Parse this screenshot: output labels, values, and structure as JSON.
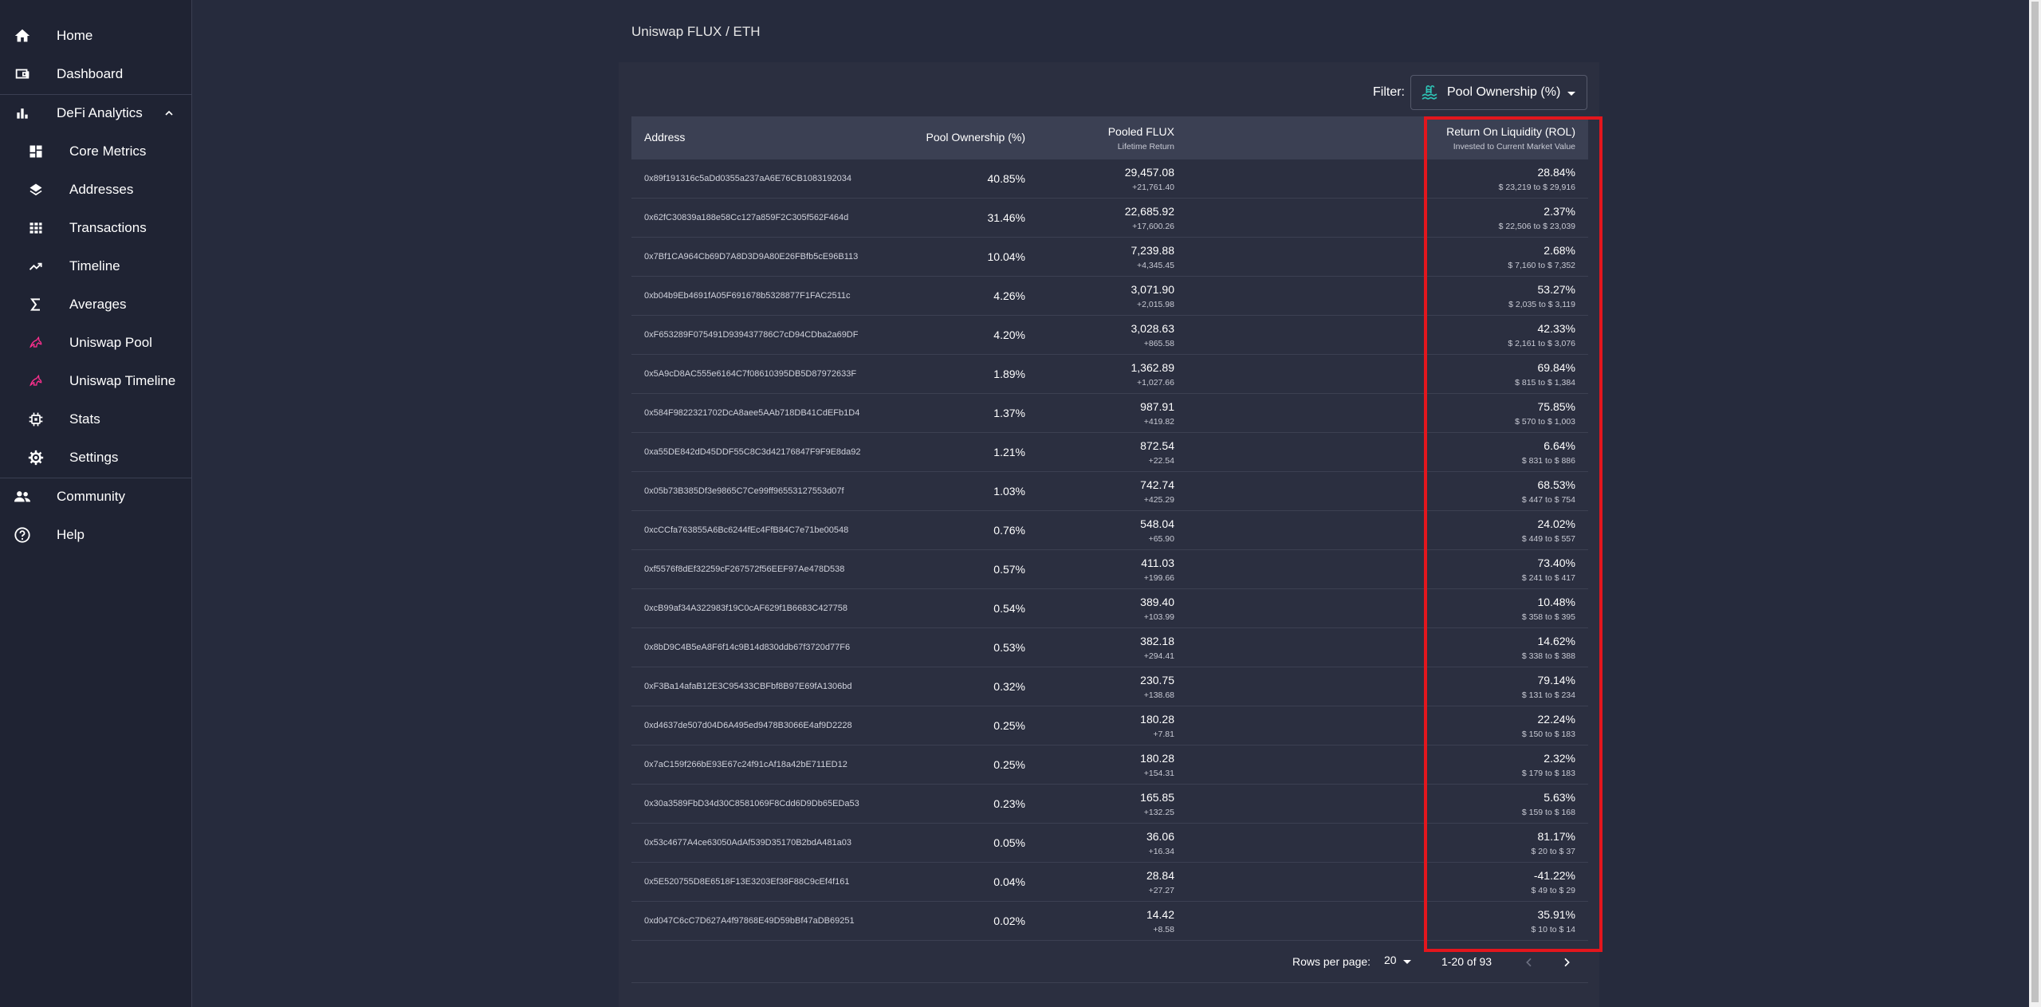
{
  "sidebar": {
    "items": [
      {
        "label": "Home",
        "icon": "home-icon"
      },
      {
        "label": "Dashboard",
        "icon": "wallet-icon"
      },
      {
        "label": "DeFi Analytics",
        "icon": "bar-chart-icon",
        "expanded": true
      },
      {
        "label": "Core Metrics",
        "icon": "dashboard-grid-icon"
      },
      {
        "label": "Addresses",
        "icon": "layers-icon"
      },
      {
        "label": "Transactions",
        "icon": "grid-table-icon"
      },
      {
        "label": "Timeline",
        "icon": "trending-up-icon"
      },
      {
        "label": "Averages",
        "icon": "sigma-icon"
      },
      {
        "label": "Uniswap Pool",
        "icon": "unicorn-icon"
      },
      {
        "label": "Uniswap Timeline",
        "icon": "unicorn-icon"
      },
      {
        "label": "Stats",
        "icon": "chip-icon"
      },
      {
        "label": "Settings",
        "icon": "gear-icon"
      },
      {
        "label": "Community",
        "icon": "people-icon"
      },
      {
        "label": "Help",
        "icon": "help-circle-icon"
      }
    ]
  },
  "page": {
    "title": "Uniswap FLUX / ETH"
  },
  "filter": {
    "label": "Filter:",
    "selected": "Pool Ownership (%)",
    "icon": "pool-icon",
    "icon_color": "#2ec4b6"
  },
  "table": {
    "headers": {
      "address": "Address",
      "ownership": "Pool Ownership (%)",
      "flux": "Pooled FLUX",
      "flux_sub": "Lifetime Return",
      "rol": "Return On Liquidity (ROL)",
      "rol_sub": "Invested to Current Market Value"
    },
    "rows": [
      {
        "address": "0x89f191316c5aDd0355a237aA6E76CB1083192034",
        "ownership": "40.85%",
        "flux": "29,457.08",
        "flux_return": "+21,761.40",
        "rol": "28.84%",
        "rol_range": "$ 23,219 to $ 29,916"
      },
      {
        "address": "0x62fC30839a188e58Cc127a859F2C305f562F464d",
        "ownership": "31.46%",
        "flux": "22,685.92",
        "flux_return": "+17,600.26",
        "rol": "2.37%",
        "rol_range": "$ 22,506 to $ 23,039"
      },
      {
        "address": "0x7Bf1CA964Cb69D7A8D3D9A80E26FBfb5cE96B113",
        "ownership": "10.04%",
        "flux": "7,239.88",
        "flux_return": "+4,345.45",
        "rol": "2.68%",
        "rol_range": "$ 7,160 to $ 7,352"
      },
      {
        "address": "0xb04b9Eb4691fA05F691678b5328877F1FAC2511c",
        "ownership": "4.26%",
        "flux": "3,071.90",
        "flux_return": "+2,015.98",
        "rol": "53.27%",
        "rol_range": "$ 2,035 to $ 3,119"
      },
      {
        "address": "0xF653289F075491D939437786C7cD94CDba2a69DF",
        "ownership": "4.20%",
        "flux": "3,028.63",
        "flux_return": "+865.58",
        "rol": "42.33%",
        "rol_range": "$ 2,161 to $ 3,076"
      },
      {
        "address": "0x5A9cD8AC555e6164C7f08610395DB5D87972633F",
        "ownership": "1.89%",
        "flux": "1,362.89",
        "flux_return": "+1,027.66",
        "rol": "69.84%",
        "rol_range": "$ 815 to $ 1,384"
      },
      {
        "address": "0x584F9822321702DcA8aee5AAb718DB41CdEFb1D4",
        "ownership": "1.37%",
        "flux": "987.91",
        "flux_return": "+419.82",
        "rol": "75.85%",
        "rol_range": "$ 570 to $ 1,003"
      },
      {
        "address": "0xa55DE842dD45DDF55C8C3d42176847F9F9E8da92",
        "ownership": "1.21%",
        "flux": "872.54",
        "flux_return": "+22.54",
        "rol": "6.64%",
        "rol_range": "$ 831 to $ 886"
      },
      {
        "address": "0x05b73B385Df3e9865C7Ce99ff96553127553d07f",
        "ownership": "1.03%",
        "flux": "742.74",
        "flux_return": "+425.29",
        "rol": "68.53%",
        "rol_range": "$ 447 to $ 754"
      },
      {
        "address": "0xcCCfa763855A6Bc6244fEc4FfB84C7e71be00548",
        "ownership": "0.76%",
        "flux": "548.04",
        "flux_return": "+65.90",
        "rol": "24.02%",
        "rol_range": "$ 449 to $ 557"
      },
      {
        "address": "0xf5576f8dEf32259cF267572f56EEF97Ae478D538",
        "ownership": "0.57%",
        "flux": "411.03",
        "flux_return": "+199.66",
        "rol": "73.40%",
        "rol_range": "$ 241 to $ 417"
      },
      {
        "address": "0xcB99af34A322983f19C0cAF629f1B6683C427758",
        "ownership": "0.54%",
        "flux": "389.40",
        "flux_return": "+103.99",
        "rol": "10.48%",
        "rol_range": "$ 358 to $ 395"
      },
      {
        "address": "0x8bD9C4B5eA8F6f14c9B14d830ddb67f3720d77F6",
        "ownership": "0.53%",
        "flux": "382.18",
        "flux_return": "+294.41",
        "rol": "14.62%",
        "rol_range": "$ 338 to $ 388"
      },
      {
        "address": "0xF3Ba14afaB12E3C95433CBFbf8B97E69fA1306bd",
        "ownership": "0.32%",
        "flux": "230.75",
        "flux_return": "+138.68",
        "rol": "79.14%",
        "rol_range": "$ 131 to $ 234"
      },
      {
        "address": "0xd4637de507d04D6A495ed9478B3066E4af9D2228",
        "ownership": "0.25%",
        "flux": "180.28",
        "flux_return": "+7.81",
        "rol": "22.24%",
        "rol_range": "$ 150 to $ 183"
      },
      {
        "address": "0x7aC159f266bE93E67c24f91cAf18a42bE711ED12",
        "ownership": "0.25%",
        "flux": "180.28",
        "flux_return": "+154.31",
        "rol": "2.32%",
        "rol_range": "$ 179 to $ 183"
      },
      {
        "address": "0x30a3589FbD34d30C8581069F8Cdd6D9Db65EDa53",
        "ownership": "0.23%",
        "flux": "165.85",
        "flux_return": "+132.25",
        "rol": "5.63%",
        "rol_range": "$ 159 to $ 168"
      },
      {
        "address": "0x53c4677A4ce63050AdAf539D35170B2bdA481a03",
        "ownership": "0.05%",
        "flux": "36.06",
        "flux_return": "+16.34",
        "rol": "81.17%",
        "rol_range": "$ 20 to $ 37"
      },
      {
        "address": "0x5E520755D8E6518F13E3203Ef38F88C9cEf4f161",
        "ownership": "0.04%",
        "flux": "28.84",
        "flux_return": "+27.27",
        "rol": "-41.22%",
        "rol_range": "$ 49 to $ 29"
      },
      {
        "address": "0xd047C6cC7D627A4f97868E49D59bBf47aDB69251",
        "ownership": "0.02%",
        "flux": "14.42",
        "flux_return": "+8.58",
        "rol": "35.91%",
        "rol_range": "$ 10 to $ 14"
      }
    ]
  },
  "pagination": {
    "rows_label": "Rows per page:",
    "rows_value": "20",
    "range": "1-20 of 93"
  },
  "colors": {
    "highlight": "#e3161d",
    "background": "#262b3d",
    "sidebar": "#1f2333",
    "accent": "#2ec4b6"
  }
}
